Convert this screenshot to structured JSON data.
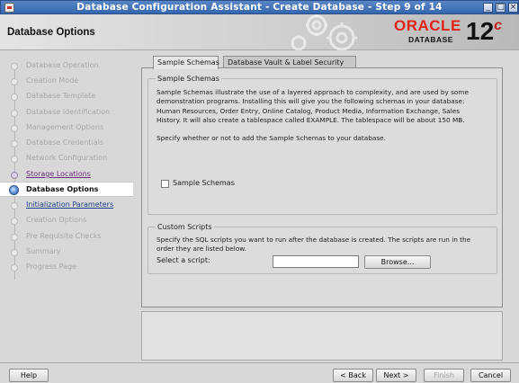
{
  "window": {
    "title": "Database Configuration Assistant - Create Database - Step 9 of 14",
    "minimize_icon": "minimize-icon",
    "maximize_icon": "maximize-icon",
    "close_icon": "close-icon"
  },
  "header": {
    "page_title": "Database Options",
    "brand": "ORACLE",
    "brand_sub": "DATABASE",
    "version": "12",
    "version_suffix": "c"
  },
  "sidebar": {
    "steps": [
      {
        "label": "Database Operation",
        "state": "disabled"
      },
      {
        "label": "Creation Mode",
        "state": "disabled"
      },
      {
        "label": "Database Template",
        "state": "disabled"
      },
      {
        "label": "Database Identification",
        "state": "disabled"
      },
      {
        "label": "Management Options",
        "state": "disabled"
      },
      {
        "label": "Database Credentials",
        "state": "disabled"
      },
      {
        "label": "Network Configuration",
        "state": "disabled"
      },
      {
        "label": "Storage Locations",
        "state": "visited"
      },
      {
        "label": "Database Options",
        "state": "active"
      },
      {
        "label": "Initialization Parameters",
        "state": "link"
      },
      {
        "label": "Creation Options",
        "state": "disabled"
      },
      {
        "label": "Pre Requisite Checks",
        "state": "disabled"
      },
      {
        "label": "Summary",
        "state": "disabled"
      },
      {
        "label": "Progress Page",
        "state": "disabled"
      }
    ]
  },
  "tabs": [
    {
      "label": "Sample Schemas",
      "active": true
    },
    {
      "label": "Database Vault & Label Security",
      "active": false
    }
  ],
  "sample_schemas": {
    "group_title": "Sample Schemas",
    "description_lines": [
      "Sample Schemas illustrate the use of a layered approach to complexity, and are used by some",
      "demonstration programs. Installing this will give you the following schemas in your database:",
      "Human Resources, Order Entry, Online Catalog, Product Media, Information Exchange, Sales",
      "History. It will also create a tablespace called EXAMPLE. The tablespace will be about 150 MB."
    ],
    "prompt": "Specify whether or not to add the Sample Schemas to your database.",
    "checkbox_label": "Sample Schemas",
    "checked": false
  },
  "custom_scripts": {
    "group_title": "Custom Scripts",
    "description_lines": [
      "Specify the SQL scripts you want to run after the database is created. The scripts are run in the",
      "order they are listed below."
    ],
    "select_label": "Select a script:",
    "script_value": "",
    "browse_label": "Browse..."
  },
  "footer": {
    "help": "Help",
    "back": "< Back",
    "next": "Next >",
    "finish": "Finish",
    "cancel": "Cancel"
  },
  "colors": {
    "titlebar": "#3566ad",
    "oracle_red": "#e2231a",
    "visited_link": "#6c2d7a",
    "link": "#1d3f8c"
  }
}
